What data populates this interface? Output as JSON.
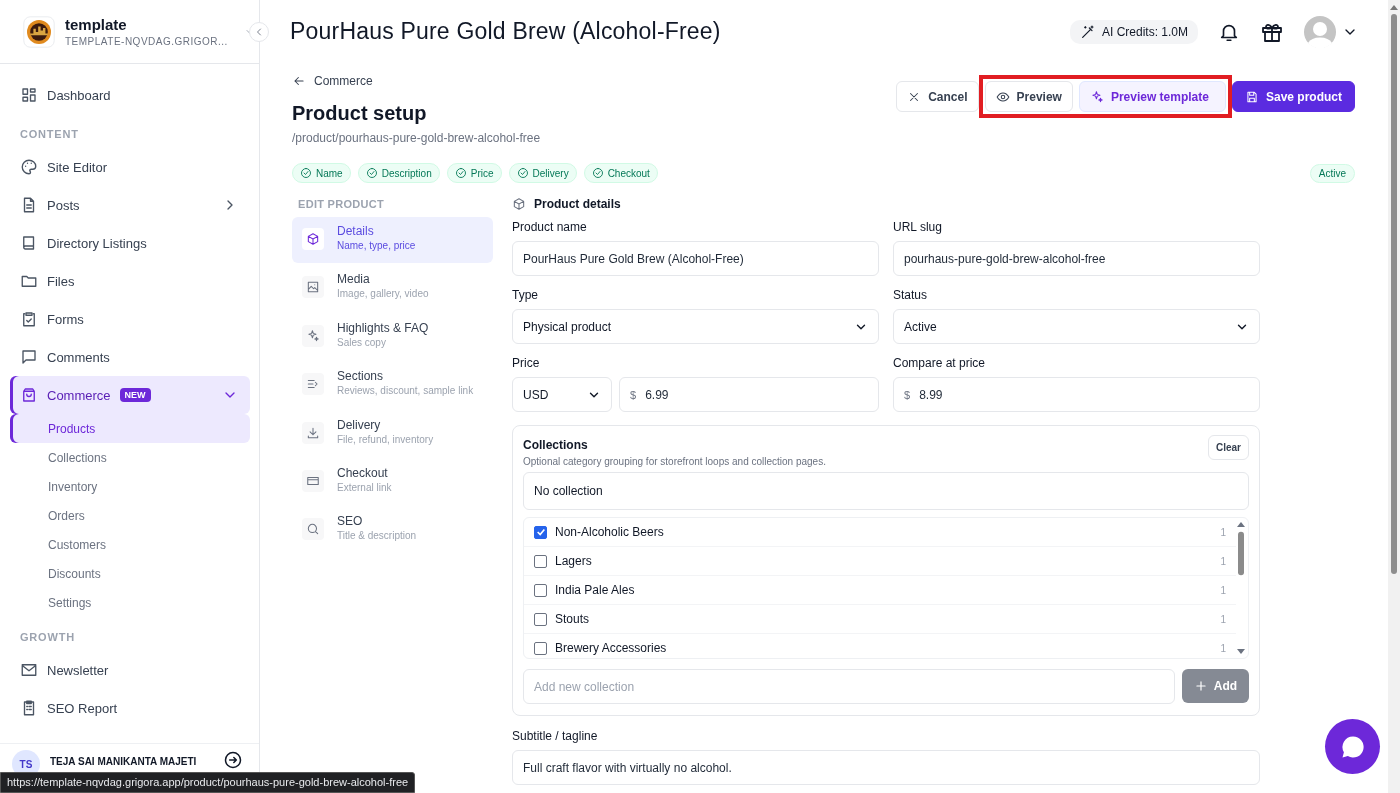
{
  "site": {
    "name": "template",
    "domain": "TEMPLATE-NQVDAG.GRIGOR..."
  },
  "sidebar": {
    "groups": [
      {
        "items": [
          {
            "label": "Dashboard",
            "selected": false
          }
        ]
      },
      {
        "heading": "CONTENT",
        "items": [
          {
            "label": "Site Editor",
            "selected": false
          },
          {
            "label": "Posts",
            "selected": false,
            "expanded": false
          },
          {
            "label": "Directory Listings",
            "selected": false
          },
          {
            "label": "Files",
            "selected": false
          },
          {
            "label": "Forms",
            "selected": false
          },
          {
            "label": "Comments",
            "selected": false
          },
          {
            "label": "Commerce",
            "selected": true,
            "expanded": true,
            "badge": "NEW",
            "children": [
              {
                "label": "Products",
                "selected": true
              },
              {
                "label": "Collections",
                "selected": false
              },
              {
                "label": "Inventory",
                "selected": false
              },
              {
                "label": "Orders",
                "selected": false
              },
              {
                "label": "Customers",
                "selected": false
              },
              {
                "label": "Discounts",
                "selected": false
              },
              {
                "label": "Settings",
                "selected": false
              }
            ]
          }
        ]
      },
      {
        "heading": "GROWTH",
        "items": [
          {
            "label": "Newsletter",
            "selected": false
          },
          {
            "label": "SEO Report",
            "selected": false
          }
        ]
      }
    ],
    "user": {
      "initials": "TS",
      "name": "TEJA SAI MANIKANTA MAJETI"
    }
  },
  "header": {
    "title": "PourHaus Pure Gold Brew (Alcohol-Free)",
    "ai_credits": "AI Credits: 1.0M"
  },
  "breadcrumb": "Commerce",
  "heading": "Product setup",
  "path": "/product/pourhaus-pure-gold-brew-alcohol-free",
  "actions": [
    {
      "label": "Cancel",
      "kind": "cancel",
      "highlighted": false
    },
    {
      "label": "Preview",
      "kind": "preview",
      "highlighted": true
    },
    {
      "label": "Preview template",
      "kind": "template",
      "highlighted": true
    },
    {
      "label": "Save product",
      "kind": "save",
      "highlighted": false
    }
  ],
  "checks": [
    "Name",
    "Description",
    "Price",
    "Delivery",
    "Checkout"
  ],
  "status_badge": "Active",
  "edit_nav": {
    "heading": "EDIT PRODUCT",
    "items": [
      {
        "title": "Details",
        "subtitle": "Name, type, price",
        "selected": true
      },
      {
        "title": "Media",
        "subtitle": "Image, gallery, video",
        "selected": false
      },
      {
        "title": "Highlights & FAQ",
        "subtitle": "Sales copy",
        "selected": false
      },
      {
        "title": "Sections",
        "subtitle": "Reviews, discount, sample link",
        "selected": false
      },
      {
        "title": "Delivery",
        "subtitle": "File, refund, inventory",
        "selected": false
      },
      {
        "title": "Checkout",
        "subtitle": "External link",
        "selected": false
      },
      {
        "title": "SEO",
        "subtitle": "Title & description",
        "selected": false
      }
    ]
  },
  "section_title": "Product details",
  "product_name": {
    "label": "Product name",
    "value": "PourHaus Pure Gold Brew (Alcohol-Free)"
  },
  "url_slug": {
    "label": "URL slug",
    "value": "pourhaus-pure-gold-brew-alcohol-free"
  },
  "type": {
    "label": "Type",
    "value": "Physical product"
  },
  "status": {
    "label": "Status",
    "value": "Active"
  },
  "price": {
    "label": "Price",
    "currency": "USD",
    "symbol": "$",
    "value": "6.99"
  },
  "compare_at_price": {
    "label": "Compare at price",
    "symbol": "$",
    "value": "8.99"
  },
  "collections": {
    "title": "Collections",
    "description": "Optional category grouping for storefront loops and collection pages.",
    "clear_label": "Clear",
    "none_option": "No collection",
    "items": [
      {
        "name": "Non-Alcoholic Beers",
        "checked": true,
        "count": "1"
      },
      {
        "name": "Lagers",
        "checked": false,
        "count": "1"
      },
      {
        "name": "India Pale Ales",
        "checked": false,
        "count": "1"
      },
      {
        "name": "Stouts",
        "checked": false,
        "count": "1"
      },
      {
        "name": "Brewery Accessories",
        "checked": false,
        "count": "1"
      }
    ],
    "add_placeholder": "Add new collection",
    "add_label": "Add"
  },
  "subtitle": {
    "label": "Subtitle / tagline",
    "value": "Full craft flavor with virtually no alcohol."
  },
  "link_preview": "https://template-nqvdag.grigora.app/product/pourhaus-pure-gold-brew-alcohol-free"
}
